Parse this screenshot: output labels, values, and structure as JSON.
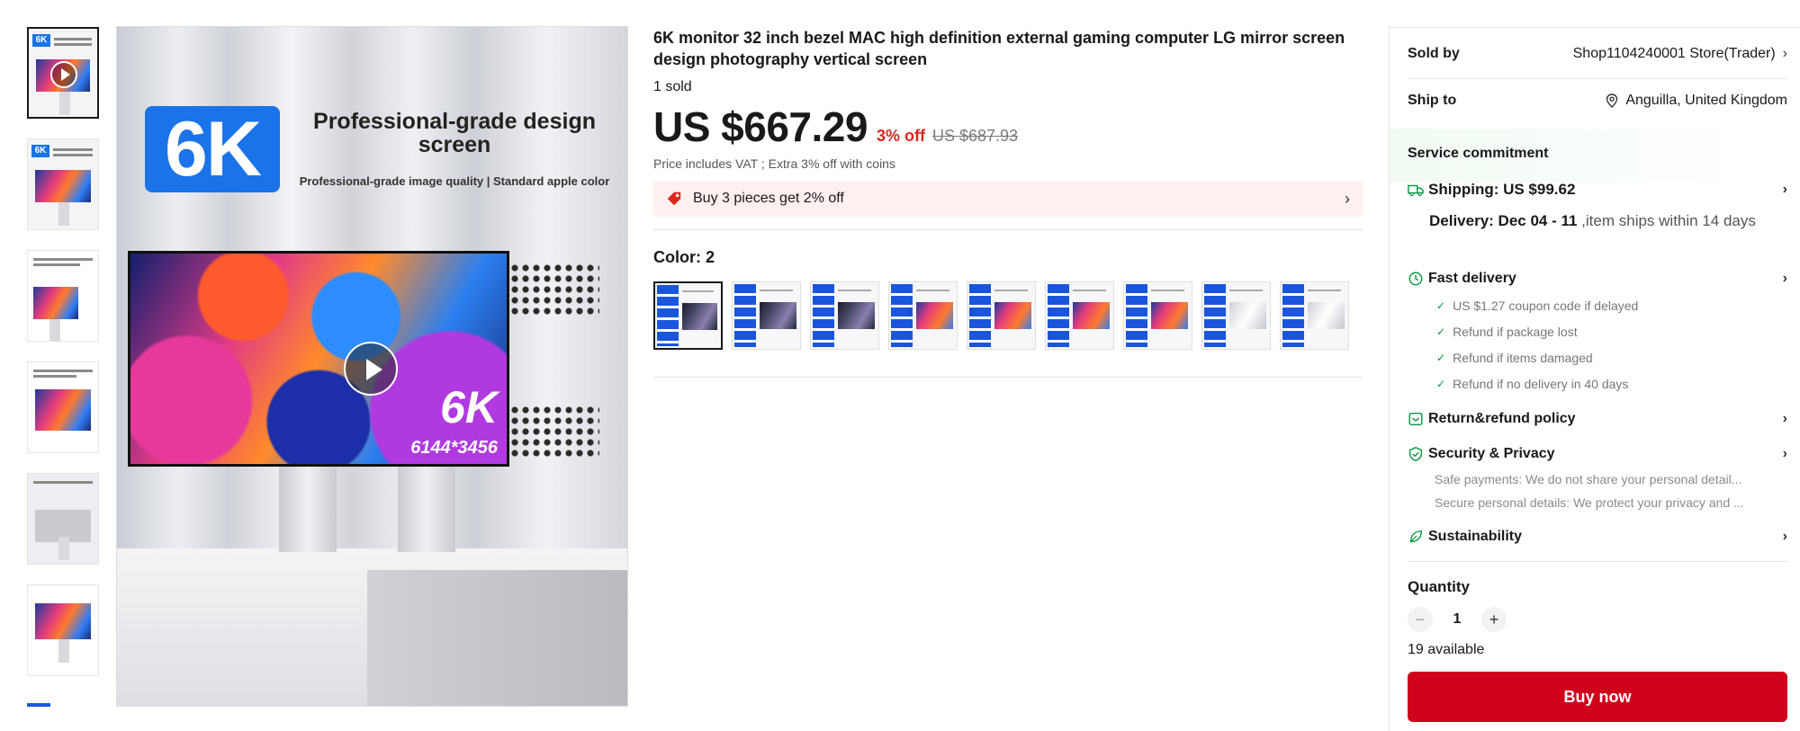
{
  "gallery": {
    "thumb_count": 6,
    "hero": {
      "badge": "6K",
      "title": "Professional-grade design screen",
      "subtitle": "Professional-grade image quality | Standard apple color",
      "screen_badge": "6K",
      "screen_resolution": "6144*3456"
    }
  },
  "product": {
    "title": "6K monitor 32 inch bezel MAC high definition external gaming computer LG mirror screen design photography vertical screen",
    "sold": "1 sold",
    "price": "US $667.29",
    "discount": "3% off",
    "original_price": "US $687.93",
    "vat_note": "Price includes VAT ; Extra 3% off with coins",
    "promo": "Buy 3 pieces get 2% off",
    "color_label": "Color: 2",
    "swatch_count": 9,
    "selected_swatch": 1
  },
  "panel": {
    "sold_by_label": "Sold by",
    "sold_by_value": "Shop1104240001 Store(Trader)",
    "ship_to_label": "Ship to",
    "ship_to_value": "Anguilla, United Kingdom",
    "service_title": "Service commitment",
    "shipping": "Shipping: US $99.62",
    "delivery_bold": "Delivery: Dec 04 - 11",
    "delivery_rest": " ,item ships within 14 days",
    "fast_delivery": "Fast delivery",
    "fast_items": [
      "US $1.27 coupon code if delayed",
      "Refund if package lost",
      "Refund if items damaged",
      "Refund if no delivery in 40 days"
    ],
    "return_policy": "Return&refund policy",
    "security": "Security & Privacy",
    "security_lines": [
      "Safe payments: We do not share your personal detail...",
      "Secure personal details: We protect your privacy and ..."
    ],
    "sustainability": "Sustainability",
    "quantity_label": "Quantity",
    "quantity_value": "1",
    "minus": "−",
    "plus": "+",
    "available": "19 available",
    "buy_now": "Buy now"
  },
  "colors": {
    "accent_red": "#e1251b",
    "buy_button": "#d0021b",
    "check_green": "#0a9a42",
    "brand_blue": "#1a73e8"
  },
  "icons": {
    "promo": "price-tag-icon",
    "ship_to": "location-pin-icon",
    "shipping": "truck-icon",
    "fast_delivery": "fast-clock-icon",
    "return": "return-box-icon",
    "security": "shield-check-icon",
    "sustainability": "leaf-icon"
  }
}
